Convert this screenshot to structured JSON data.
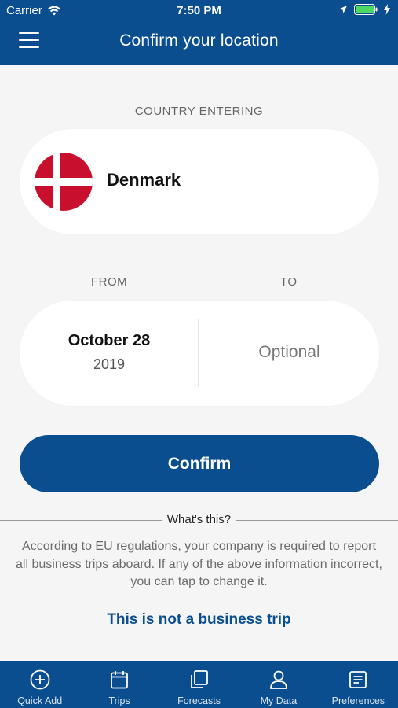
{
  "status_bar": {
    "carrier": "Carrier",
    "time": "7:50 PM",
    "battery_color": "#4cd964"
  },
  "nav": {
    "title": "Confirm your location",
    "menu_icon": "hamburger-icon"
  },
  "country": {
    "label": "COUNTRY ENTERING",
    "name": "Denmark",
    "flag_icon": "denmark-flag-icon"
  },
  "dates": {
    "from_label": "FROM",
    "to_label": "TO",
    "from_date": "October 28",
    "from_year": "2019",
    "to_placeholder": "Optional"
  },
  "confirm_label": "Confirm",
  "info": {
    "heading": "What's this?",
    "body": "According to EU regulations, your company is required to report all business trips aboard. If any of the above information incorrect, you can tap to change it.",
    "link": "This is not a business trip"
  },
  "tabs": [
    {
      "label": "Quick Add",
      "icon": "plus-circle-icon"
    },
    {
      "label": "Trips",
      "icon": "calendar-icon"
    },
    {
      "label": "Forecasts",
      "icon": "stacked-cards-icon"
    },
    {
      "label": "My Data",
      "icon": "person-icon"
    },
    {
      "label": "Preferences",
      "icon": "document-list-icon"
    }
  ],
  "colors": {
    "brand": "#0a4e8f",
    "background": "#f5f5f5",
    "flag_red": "#c8102e"
  }
}
